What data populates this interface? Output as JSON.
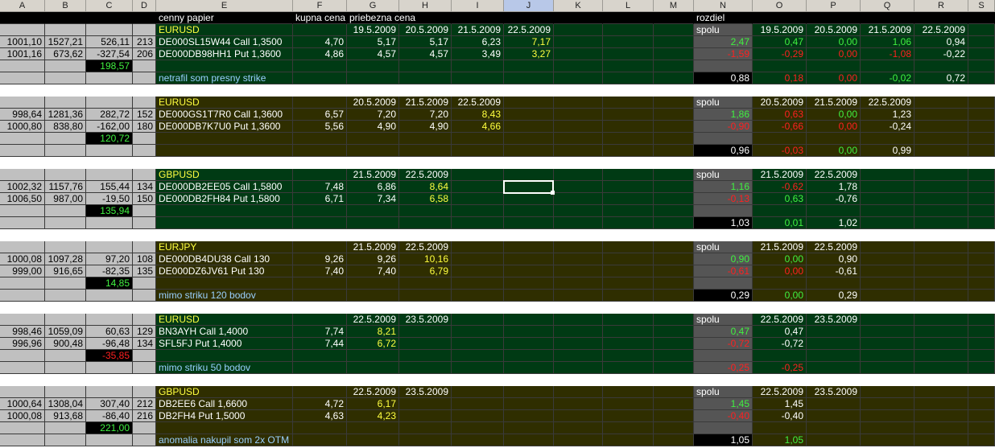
{
  "column_headers": [
    "A",
    "B",
    "C",
    "D",
    "E",
    "F",
    "G",
    "H",
    "I",
    "J",
    "K",
    "L",
    "M",
    "N",
    "O",
    "P",
    "Q",
    "R",
    "S"
  ],
  "selected_column": "J",
  "colors": {
    "black": "#000000",
    "green_bg": "#003a14",
    "olive_bg": "#2f2e00",
    "grey_a": "#c0c0c0",
    "n_grey": "#555555",
    "n_black": "#000000",
    "yellow": "#ffff40",
    "green": "#40f040",
    "red": "#ff2020",
    "white": "#ffffff",
    "cyan": "#9ad0ff",
    "bright_green_txt": "#00ff40",
    "spacer": "#ffffff"
  },
  "header_row": {
    "E": "cenny papier",
    "F": "kupna cena",
    "G": "priebezna cena",
    "N": "rozdiel"
  },
  "rows": [
    {
      "style": "green",
      "cells": {
        "E": {
          "t": "EURUSD",
          "c": "yellow"
        },
        "G": {
          "t": "19.5.2009"
        },
        "H": {
          "t": "20.5.2009"
        },
        "I": {
          "t": "21.5.2009"
        },
        "J": {
          "t": "22.5.2009"
        },
        "N": {
          "t": "spolu"
        },
        "O": {
          "t": "19.5.2009"
        },
        "P": {
          "t": "20.5.2009"
        },
        "Q": {
          "t": "21.5.2009"
        },
        "R": {
          "t": "22.5.2009"
        }
      }
    },
    {
      "style": "green",
      "cells": {
        "A": {
          "t": "1001,10"
        },
        "B": {
          "t": "1527,21"
        },
        "C": {
          "t": "526,11"
        },
        "D": {
          "t": "213"
        },
        "E": {
          "t": "DE000SL15W44 Call 1,3500"
        },
        "F": {
          "t": "4,70"
        },
        "G": {
          "t": "5,17"
        },
        "H": {
          "t": "5,17"
        },
        "I": {
          "t": "6,23"
        },
        "J": {
          "t": "7,17",
          "c": "yellow"
        },
        "N": {
          "t": "2,47",
          "c": "green"
        },
        "O": {
          "t": "0,47",
          "c": "green"
        },
        "P": {
          "t": "0,00",
          "c": "green"
        },
        "Q": {
          "t": "1,06",
          "c": "green"
        },
        "R": {
          "t": "0,94"
        }
      }
    },
    {
      "style": "green",
      "cells": {
        "A": {
          "t": "1001,16"
        },
        "B": {
          "t": "673,62"
        },
        "C": {
          "t": "-327,54"
        },
        "D": {
          "t": "206"
        },
        "E": {
          "t": "DE000DB98HH1 Put 1,3600"
        },
        "F": {
          "t": "4,86"
        },
        "G": {
          "t": "4,57"
        },
        "H": {
          "t": "4,57"
        },
        "I": {
          "t": "3,49"
        },
        "J": {
          "t": "3,27",
          "c": "yellow"
        },
        "N": {
          "t": "-1,59",
          "c": "red"
        },
        "O": {
          "t": "-0,29",
          "c": "red"
        },
        "P": {
          "t": "0,00",
          "c": "red"
        },
        "Q": {
          "t": "-1,08",
          "c": "red"
        },
        "R": {
          "t": "-0,22"
        }
      }
    },
    {
      "style": "green",
      "cells": {
        "C": {
          "t": "198,57",
          "c": "green",
          "bg": "black"
        }
      }
    },
    {
      "style": "green",
      "cells": {
        "E": {
          "t": "netrafil som presny strike",
          "c": "cyan"
        },
        "N": {
          "t": "0,88",
          "nb": "black"
        },
        "O": {
          "t": "0,18",
          "c": "red"
        },
        "P": {
          "t": "0,00",
          "c": "red"
        },
        "Q": {
          "t": "-0,02",
          "c": "green"
        },
        "R": {
          "t": "0,72"
        }
      }
    },
    {
      "style": "spacer",
      "cells": {}
    },
    {
      "style": "olive",
      "cells": {
        "E": {
          "t": "EURUSD",
          "c": "yellow"
        },
        "G": {
          "t": "20.5.2009"
        },
        "H": {
          "t": "21.5.2009"
        },
        "I": {
          "t": "22.5.2009"
        },
        "N": {
          "t": "spolu"
        },
        "O": {
          "t": "20.5.2009"
        },
        "P": {
          "t": "21.5.2009"
        },
        "Q": {
          "t": "22.5.2009"
        }
      }
    },
    {
      "style": "olive",
      "cells": {
        "A": {
          "t": "998,64"
        },
        "B": {
          "t": "1281,36"
        },
        "C": {
          "t": "282,72"
        },
        "D": {
          "t": "152"
        },
        "E": {
          "t": "DE000GS1T7R0 Call 1,3600"
        },
        "F": {
          "t": "6,57"
        },
        "G": {
          "t": "7,20"
        },
        "H": {
          "t": "7,20"
        },
        "I": {
          "t": "8,43",
          "c": "yellow"
        },
        "N": {
          "t": "1,86",
          "c": "green"
        },
        "O": {
          "t": "0,63",
          "c": "red"
        },
        "P": {
          "t": "0,00",
          "c": "green"
        },
        "Q": {
          "t": "1,23"
        }
      }
    },
    {
      "style": "olive",
      "cells": {
        "A": {
          "t": "1000,80"
        },
        "B": {
          "t": "838,80"
        },
        "C": {
          "t": "-162,00"
        },
        "D": {
          "t": "180"
        },
        "E": {
          "t": "DE000DB7K7U0  Put 1,3600"
        },
        "F": {
          "t": "5,56"
        },
        "G": {
          "t": "4,90"
        },
        "H": {
          "t": "4,90"
        },
        "I": {
          "t": "4,66",
          "c": "yellow"
        },
        "N": {
          "t": "-0,90",
          "c": "red"
        },
        "O": {
          "t": "-0,66",
          "c": "red"
        },
        "P": {
          "t": "0,00",
          "c": "red"
        },
        "Q": {
          "t": "-0,24"
        }
      }
    },
    {
      "style": "olive",
      "cells": {
        "C": {
          "t": "120,72",
          "c": "green",
          "bg": "black"
        }
      }
    },
    {
      "style": "olive",
      "cells": {
        "N": {
          "t": "0,96",
          "nb": "black"
        },
        "O": {
          "t": "-0,03",
          "c": "red"
        },
        "P": {
          "t": "0,00",
          "c": "green"
        },
        "Q": {
          "t": "0,99"
        }
      }
    },
    {
      "style": "spacer",
      "cells": {}
    },
    {
      "style": "green",
      "cells": {
        "E": {
          "t": "GBPUSD",
          "c": "yellow"
        },
        "G": {
          "t": "21.5.2009"
        },
        "H": {
          "t": "22.5.2009"
        },
        "N": {
          "t": "spolu"
        },
        "O": {
          "t": "21.5.2009"
        },
        "P": {
          "t": "22.5.2009"
        }
      }
    },
    {
      "style": "green",
      "cells": {
        "A": {
          "t": "1002,32"
        },
        "B": {
          "t": "1157,76"
        },
        "C": {
          "t": "155,44"
        },
        "D": {
          "t": "134"
        },
        "E": {
          "t": "DE000DB2EE05 Call 1,5800"
        },
        "F": {
          "t": "7,48"
        },
        "G": {
          "t": "6,86"
        },
        "H": {
          "t": "8,64",
          "c": "yellow"
        },
        "N": {
          "t": "1,16",
          "c": "green"
        },
        "O": {
          "t": "-0,62",
          "c": "red"
        },
        "P": {
          "t": "1,78"
        }
      }
    },
    {
      "style": "green",
      "cells": {
        "A": {
          "t": "1006,50"
        },
        "B": {
          "t": "987,00"
        },
        "C": {
          "t": "-19,50"
        },
        "D": {
          "t": "150"
        },
        "E": {
          "t": "DE000DB2FH84  Put 1,5800"
        },
        "F": {
          "t": "6,71"
        },
        "G": {
          "t": "7,34"
        },
        "H": {
          "t": "6,58",
          "c": "yellow"
        },
        "N": {
          "t": "-0,13",
          "c": "red"
        },
        "O": {
          "t": "0,63",
          "c": "green"
        },
        "P": {
          "t": "-0,76"
        }
      }
    },
    {
      "style": "green",
      "cells": {
        "C": {
          "t": "135,94",
          "c": "green",
          "bg": "black"
        }
      }
    },
    {
      "style": "green",
      "cells": {
        "N": {
          "t": "1,03",
          "nb": "black"
        },
        "O": {
          "t": "0,01",
          "c": "green"
        },
        "P": {
          "t": "1,02"
        }
      }
    },
    {
      "style": "spacer",
      "cells": {}
    },
    {
      "style": "olive",
      "cells": {
        "E": {
          "t": "EURJPY",
          "c": "yellow"
        },
        "G": {
          "t": "21.5.2009"
        },
        "H": {
          "t": "22.5.2009"
        },
        "N": {
          "t": "spolu"
        },
        "O": {
          "t": "21.5.2009"
        },
        "P": {
          "t": "22.5.2009"
        }
      }
    },
    {
      "style": "olive",
      "cells": {
        "A": {
          "t": "1000,08"
        },
        "B": {
          "t": "1097,28"
        },
        "C": {
          "t": "97,20"
        },
        "D": {
          "t": "108"
        },
        "E": {
          "t": "DE000DB4DU38 Call 130"
        },
        "F": {
          "t": "9,26"
        },
        "G": {
          "t": "9,26"
        },
        "H": {
          "t": "10,16",
          "c": "yellow"
        },
        "N": {
          "t": "0,90",
          "c": "green"
        },
        "O": {
          "t": "0,00",
          "c": "green"
        },
        "P": {
          "t": "0,90"
        }
      }
    },
    {
      "style": "olive",
      "cells": {
        "A": {
          "t": "999,00"
        },
        "B": {
          "t": "916,65"
        },
        "C": {
          "t": "-82,35"
        },
        "D": {
          "t": "135"
        },
        "E": {
          "t": "DE000DZ6JV61  Put 130"
        },
        "F": {
          "t": "7,40"
        },
        "G": {
          "t": "7,40"
        },
        "H": {
          "t": "6,79",
          "c": "yellow"
        },
        "N": {
          "t": "-0,61",
          "c": "red"
        },
        "O": {
          "t": "0,00",
          "c": "red"
        },
        "P": {
          "t": "-0,61"
        }
      }
    },
    {
      "style": "olive",
      "cells": {
        "C": {
          "t": "14,85",
          "c": "green",
          "bg": "black"
        }
      }
    },
    {
      "style": "olive",
      "cells": {
        "E": {
          "t": "mimo striku 120 bodov",
          "c": "cyan"
        },
        "N": {
          "t": "0,29",
          "nb": "black"
        },
        "O": {
          "t": "0,00",
          "c": "green"
        },
        "P": {
          "t": "0,29"
        }
      }
    },
    {
      "style": "spacer",
      "cells": {}
    },
    {
      "style": "green",
      "cells": {
        "E": {
          "t": "EURUSD",
          "c": "yellow"
        },
        "G": {
          "t": "22.5.2009"
        },
        "H": {
          "t": "23.5.2009"
        },
        "N": {
          "t": "spolu"
        },
        "O": {
          "t": "22.5.2009"
        },
        "P": {
          "t": "23.5.2009"
        }
      }
    },
    {
      "style": "green",
      "cells": {
        "A": {
          "t": "998,46"
        },
        "B": {
          "t": "1059,09"
        },
        "C": {
          "t": "60,63"
        },
        "D": {
          "t": "129"
        },
        "E": {
          "t": "BN3AYH Call 1,4000"
        },
        "F": {
          "t": "7,74"
        },
        "G": {
          "t": "8,21",
          "c": "yellow"
        },
        "N": {
          "t": "0,47",
          "c": "green"
        },
        "O": {
          "t": "0,47"
        }
      }
    },
    {
      "style": "green",
      "cells": {
        "A": {
          "t": "996,96"
        },
        "B": {
          "t": "900,48"
        },
        "C": {
          "t": "-96,48"
        },
        "D": {
          "t": "134"
        },
        "E": {
          "t": "SFL5FJ  Put 1,4000"
        },
        "F": {
          "t": "7,44"
        },
        "G": {
          "t": "6,72",
          "c": "yellow"
        },
        "N": {
          "t": "-0,72",
          "c": "red"
        },
        "O": {
          "t": "-0,72"
        }
      }
    },
    {
      "style": "green",
      "cells": {
        "C": {
          "t": "-35,85",
          "c": "red",
          "bg": "black"
        }
      }
    },
    {
      "style": "green",
      "cells": {
        "E": {
          "t": "mimo striku 50 bodov",
          "c": "cyan"
        },
        "N": {
          "t": "-0,25",
          "c": "red"
        },
        "O": {
          "t": "-0,25",
          "c": "red"
        }
      }
    },
    {
      "style": "spacer",
      "cells": {}
    },
    {
      "style": "olive",
      "cells": {
        "E": {
          "t": "GBPUSD",
          "c": "yellow"
        },
        "G": {
          "t": "22.5.2009"
        },
        "H": {
          "t": "23.5.2009"
        },
        "N": {
          "t": "spolu"
        },
        "O": {
          "t": "22.5.2009"
        },
        "P": {
          "t": "23.5.2009"
        }
      }
    },
    {
      "style": "olive",
      "cells": {
        "A": {
          "t": "1000,64"
        },
        "B": {
          "t": "1308,04"
        },
        "C": {
          "t": "307,40"
        },
        "D": {
          "t": "212"
        },
        "E": {
          "t": "DB2EE6   Call 1,6600"
        },
        "F": {
          "t": "4,72"
        },
        "G": {
          "t": "6,17",
          "c": "yellow"
        },
        "N": {
          "t": "1,45",
          "c": "green"
        },
        "O": {
          "t": "1,45"
        }
      }
    },
    {
      "style": "olive",
      "cells": {
        "A": {
          "t": "1000,08"
        },
        "B": {
          "t": "913,68"
        },
        "C": {
          "t": "-86,40"
        },
        "D": {
          "t": "216"
        },
        "E": {
          "t": "DB2FH4   Put 1,5000"
        },
        "F": {
          "t": "4,63"
        },
        "G": {
          "t": "4,23",
          "c": "yellow"
        },
        "N": {
          "t": "-0,40",
          "c": "red"
        },
        "O": {
          "t": "-0,40"
        }
      }
    },
    {
      "style": "olive",
      "cells": {
        "C": {
          "t": "221,00",
          "c": "green",
          "bg": "black"
        }
      }
    },
    {
      "style": "olive",
      "cells": {
        "E": {
          "t": "anomalia nakupil som 2x OTM",
          "c": "cyan"
        },
        "N": {
          "t": "1,05",
          "nb": "black"
        },
        "O": {
          "t": "1,05",
          "c": "green"
        }
      }
    }
  ]
}
